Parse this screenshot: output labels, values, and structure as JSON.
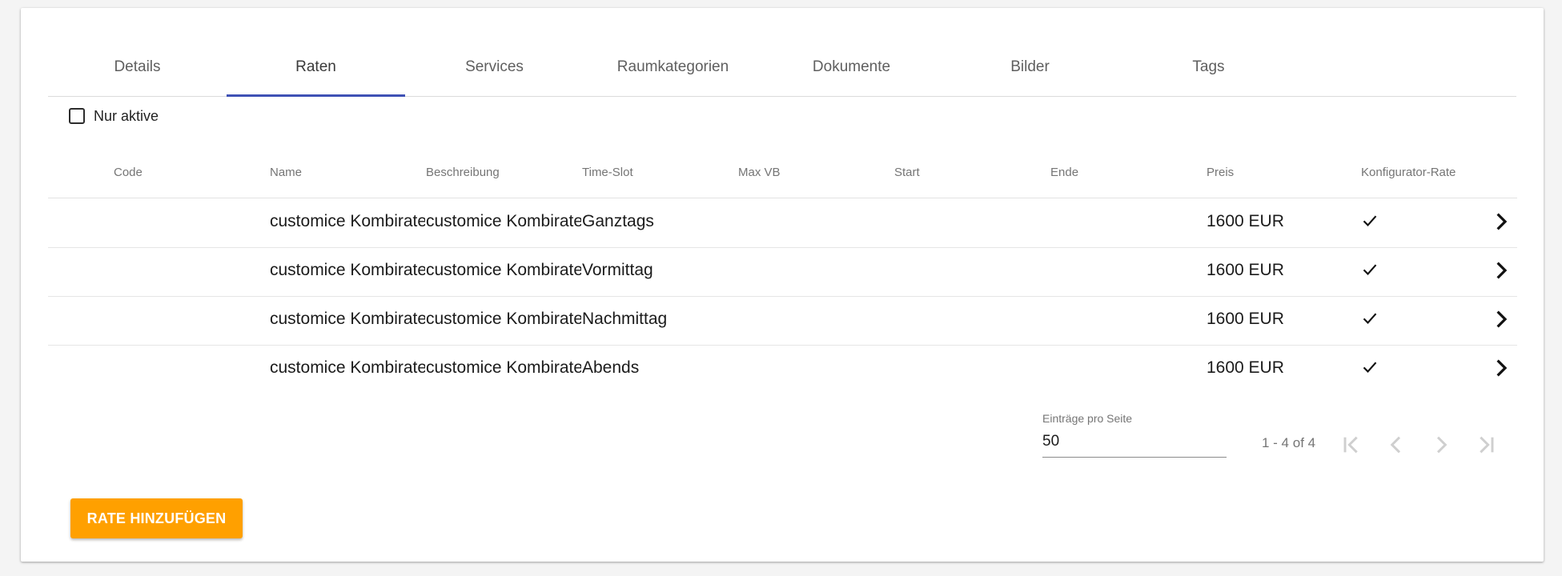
{
  "tabs": [
    {
      "label": "Details"
    },
    {
      "label": "Raten"
    },
    {
      "label": "Services"
    },
    {
      "label": "Raumkategorien"
    },
    {
      "label": "Dokumente"
    },
    {
      "label": "Bilder"
    },
    {
      "label": "Tags"
    }
  ],
  "active_tab": "Raten",
  "filter": {
    "label": "Nur aktive",
    "checked": false
  },
  "table": {
    "columns": [
      "Code",
      "Name",
      "Beschreibung",
      "Time-Slot",
      "Max VB",
      "Start",
      "Ende",
      "Preis",
      "Konfigurator-Rate"
    ],
    "rows": [
      {
        "code": "",
        "name": "customice Kombirate",
        "beschreibung": "customice Kombirate",
        "time_slot": "Ganztags",
        "max_vb": "",
        "start": "",
        "ende": "",
        "preis": "1600 EUR",
        "konfigurator_rate": "check-icon"
      },
      {
        "code": "",
        "name": "customice Kombirate",
        "beschreibung": "customice Kombirate",
        "time_slot": "Vormittag",
        "max_vb": "",
        "start": "",
        "ende": "",
        "preis": "1600 EUR",
        "konfigurator_rate": "check-icon"
      },
      {
        "code": "",
        "name": "customice Kombirate",
        "beschreibung": "customice Kombirate",
        "time_slot": "Nachmittag",
        "max_vb": "",
        "start": "",
        "ende": "",
        "preis": "1600 EUR",
        "konfigurator_rate": "check-icon"
      },
      {
        "code": "",
        "name": "customice Kombirate",
        "beschreibung": "customice Kombirate",
        "time_slot": "Abends",
        "max_vb": "",
        "start": "",
        "ende": "",
        "preis": "1600 EUR",
        "konfigurator_rate": "check-icon"
      }
    ]
  },
  "paginator": {
    "page_size_label": "Einträge pro Seite",
    "page_size": "50",
    "range_label": "1 - 4 of 4"
  },
  "add_button": {
    "label": "RATE HINZUFÜGEN"
  },
  "colors": {
    "tab_indicator": "#3f51b5",
    "add_button": "#ffa000"
  }
}
